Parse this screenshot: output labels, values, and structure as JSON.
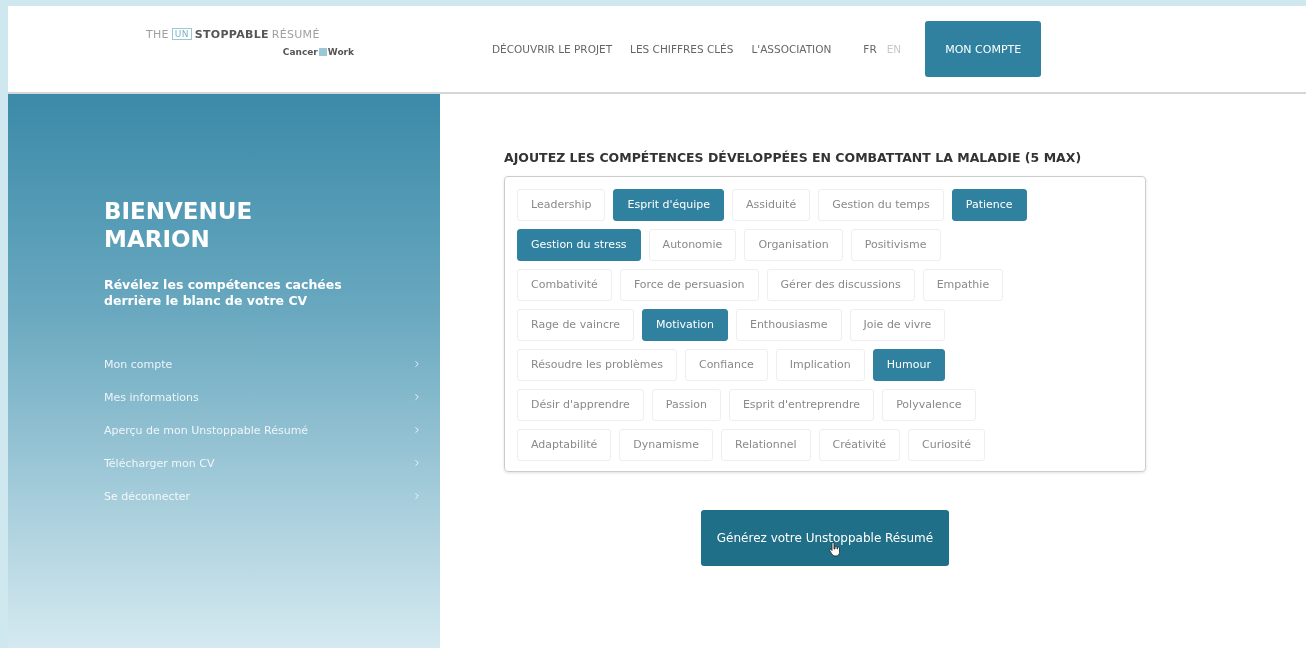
{
  "logo": {
    "prefix": "THE",
    "mark": "UN",
    "main": "STOPPABLE",
    "suffix": "RÉSUMÉ",
    "tagline_left": "Cancer",
    "tagline_right": "Work"
  },
  "nav": {
    "links": [
      "DÉCOUVRIR LE PROJET",
      "LES CHIFFRES CLÉS",
      "L'ASSOCIATION"
    ],
    "languages": [
      {
        "label": "FR",
        "selected": true
      },
      {
        "label": "EN",
        "selected": false
      }
    ],
    "account_button": "MON COMPTE"
  },
  "sidebar": {
    "title": "BIENVENUE MARION",
    "subtitle": "Révélez les compétences cachées derrière le blanc de votre CV",
    "items": [
      "Mon compte",
      "Mes informations",
      "Aperçu de mon Unstoppable Résumé",
      "Télécharger mon CV",
      "Se déconnecter"
    ]
  },
  "skills": {
    "heading": "AJOUTEZ LES COMPÉTENCES DÉVELOPPÉES EN COMBATTANT LA MALADIE (5 MAX)",
    "rows": [
      [
        {
          "label": "Leadership",
          "selected": false
        },
        {
          "label": "Esprit d'équipe",
          "selected": true
        },
        {
          "label": "Assiduité",
          "selected": false
        },
        {
          "label": "Gestion du temps",
          "selected": false
        },
        {
          "label": "Patience",
          "selected": true
        }
      ],
      [
        {
          "label": "Gestion du stress",
          "selected": true
        },
        {
          "label": "Autonomie",
          "selected": false
        },
        {
          "label": "Organisation",
          "selected": false
        },
        {
          "label": "Positivisme",
          "selected": false
        }
      ],
      [
        {
          "label": "Combativité",
          "selected": false
        },
        {
          "label": "Force de persuasion",
          "selected": false
        },
        {
          "label": "Gérer des discussions",
          "selected": false
        },
        {
          "label": "Empathie",
          "selected": false
        }
      ],
      [
        {
          "label": "Rage de vaincre",
          "selected": false
        },
        {
          "label": "Motivation",
          "selected": true
        },
        {
          "label": "Enthousiasme",
          "selected": false
        },
        {
          "label": "Joie de vivre",
          "selected": false
        }
      ],
      [
        {
          "label": "Résoudre les problèmes",
          "selected": false
        },
        {
          "label": "Confiance",
          "selected": false
        },
        {
          "label": "Implication",
          "selected": false
        },
        {
          "label": "Humour",
          "selected": true
        }
      ],
      [
        {
          "label": "Désir d'apprendre",
          "selected": false
        },
        {
          "label": "Passion",
          "selected": false
        },
        {
          "label": "Esprit d'entreprendre",
          "selected": false
        },
        {
          "label": "Polyvalence",
          "selected": false
        }
      ],
      [
        {
          "label": "Adaptabilité",
          "selected": false
        },
        {
          "label": "Dynamisme",
          "selected": false
        },
        {
          "label": "Relationnel",
          "selected": false
        },
        {
          "label": "Créativité",
          "selected": false
        },
        {
          "label": "Curiosité",
          "selected": false
        }
      ]
    ]
  },
  "generate_button": "Générez votre Unstoppable Résumé"
}
